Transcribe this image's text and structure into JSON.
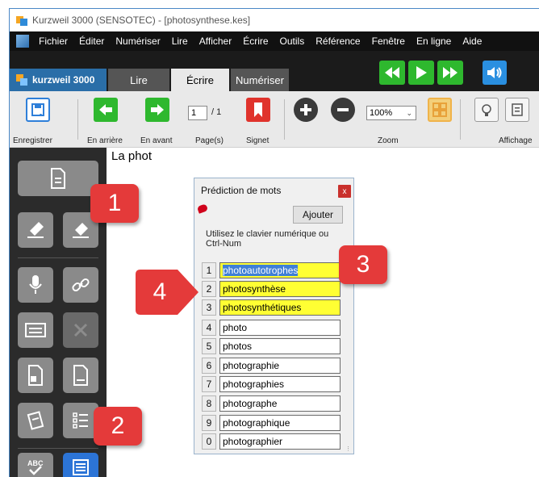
{
  "window": {
    "title": "Kurzweil 3000 (SENSOTEC) - [photosynthese.kes]"
  },
  "menu": {
    "items": [
      "Fichier",
      "Éditer",
      "Numériser",
      "Lire",
      "Afficher",
      "Écrire",
      "Outils",
      "Référence",
      "Fenêtre",
      "En ligne",
      "Aide"
    ]
  },
  "tabs": {
    "brand": "kurzweil 3000",
    "items": [
      "Lire",
      "Écrire",
      "Numériser"
    ],
    "active": "Écrire"
  },
  "toolbar": {
    "save": "Enregistrer",
    "back": "En arrière",
    "forward": "En avant",
    "page_value": "1",
    "page_total": "/ 1",
    "pages": "Page(s)",
    "bookmark": "Signet",
    "zoom_value": "100%",
    "zoom": "Zoom",
    "display": "Affichage"
  },
  "document": {
    "text": "La phot"
  },
  "prediction": {
    "title": "Prédiction de mots",
    "close": "x",
    "add": "Ajouter",
    "instructions": "Utilisez le clavier numérique ou Ctrl-Num",
    "words": [
      {
        "num": "1",
        "word": "photoautotrophes"
      },
      {
        "num": "2",
        "word": "photosynthèse"
      },
      {
        "num": "3",
        "word": "photosynthétiques"
      },
      {
        "num": "4",
        "word": "photo"
      },
      {
        "num": "5",
        "word": "photos"
      },
      {
        "num": "6",
        "word": "photographie"
      },
      {
        "num": "7",
        "word": "photographies"
      },
      {
        "num": "8",
        "word": "photographe"
      },
      {
        "num": "9",
        "word": "photographique"
      },
      {
        "num": "0",
        "word": "photographier"
      }
    ]
  },
  "callouts": [
    "1",
    "2",
    "3",
    "4"
  ],
  "colors": {
    "highlight": "#ffff33",
    "callout": "#e43a3a",
    "accent_green": "#2eb82e",
    "accent_blue": "#2a6ea8"
  }
}
